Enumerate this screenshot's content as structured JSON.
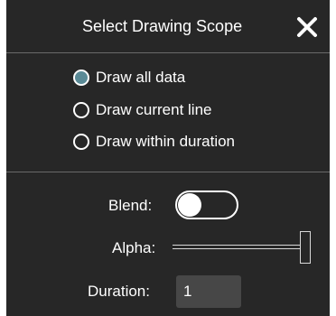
{
  "dialog": {
    "title": "Select Drawing Scope",
    "close_icon": "close-icon"
  },
  "scope": {
    "selected": 0,
    "options": [
      {
        "label": "Draw all data",
        "checked": true
      },
      {
        "label": "Draw current line",
        "checked": false
      },
      {
        "label": "Draw within duration",
        "checked": false
      }
    ]
  },
  "blend": {
    "label": "Blend:",
    "on": false
  },
  "alpha": {
    "label": "Alpha:",
    "value": 1.0
  },
  "duration": {
    "label": "Duration:",
    "value": "1"
  },
  "colors": {
    "background": "#272727",
    "radio_selected": "#5a8a96",
    "input_background": "#474747",
    "divider": "#6a6a6a",
    "text": "#ffffff"
  }
}
